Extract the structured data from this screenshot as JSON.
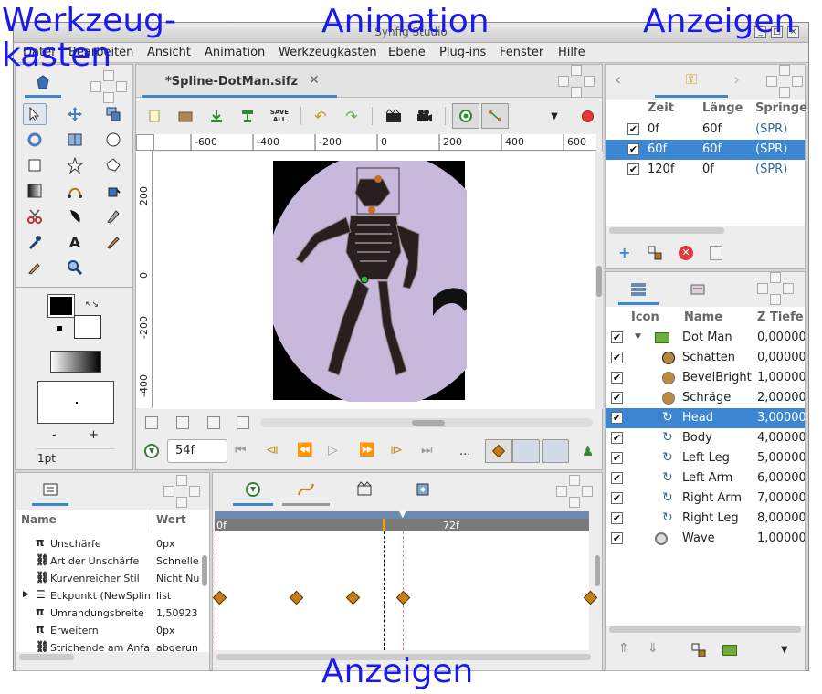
{
  "overlays": {
    "toolbox": "Werkzeug-\nkasten",
    "animation": "Animation",
    "display_top": "Anzeigen",
    "display_bottom": "Anzeigen"
  },
  "window": {
    "title": "Synfig Studio"
  },
  "menu": [
    "Datei",
    "Bearbeiten",
    "Ansicht",
    "Animation",
    "Werkzeugkasten",
    "Ebene",
    "Plug-ins",
    "Fenster",
    "Hilfe"
  ],
  "canvas": {
    "tab_title": "*Spline-DotMan.sifz",
    "toolbar_save_all": "SAVE ALL",
    "ruler_x": [
      "-600",
      "-400",
      "-200",
      "0",
      "200",
      "400",
      "600"
    ],
    "ruler_y": [
      "200",
      "0",
      "-200",
      "-400"
    ],
    "time_field": "54f",
    "ellipsis": "..."
  },
  "toolbox": {
    "width_label": "1pt",
    "minus": "-",
    "plus": "+"
  },
  "keyframes": {
    "headers": [
      "Zeit",
      "Länge",
      "Springe"
    ],
    "rows": [
      {
        "time": "0f",
        "length": "60f",
        "jump": "(SPR)",
        "selected": false
      },
      {
        "time": "60f",
        "length": "60f",
        "jump": "(SPR)",
        "selected": true
      },
      {
        "time": "120f",
        "length": "0f",
        "jump": "(SPR)",
        "selected": false
      }
    ]
  },
  "layers": {
    "headers": [
      "Icon",
      "Name",
      "Z Tiefe"
    ],
    "rows": [
      {
        "name": "Dot Man",
        "z": "0,000000",
        "icon": "folder-icon",
        "indent": 0,
        "selected": false
      },
      {
        "name": "Schatten",
        "z": "0,000000",
        "icon": "circle-layer-icon",
        "indent": 1,
        "selected": false
      },
      {
        "name": "BevelBright",
        "z": "1,000000",
        "icon": "circle-layer-icon",
        "indent": 1,
        "selected": false
      },
      {
        "name": "Schräge",
        "z": "2,000000",
        "icon": "circle-layer-icon",
        "indent": 1,
        "selected": false
      },
      {
        "name": "Head",
        "z": "3,000000",
        "icon": "spline-layer-icon",
        "indent": 1,
        "selected": true
      },
      {
        "name": "Body",
        "z": "4,000000",
        "icon": "spline-layer-icon",
        "indent": 1,
        "selected": false
      },
      {
        "name": "Left Leg",
        "z": "5,000000",
        "icon": "spline-layer-icon",
        "indent": 1,
        "selected": false
      },
      {
        "name": "Left Arm",
        "z": "6,000000",
        "icon": "spline-layer-icon",
        "indent": 1,
        "selected": false
      },
      {
        "name": "Right Arm",
        "z": "7,000000",
        "icon": "spline-layer-icon",
        "indent": 1,
        "selected": false
      },
      {
        "name": "Right Leg",
        "z": "8,000000",
        "icon": "spline-layer-icon",
        "indent": 1,
        "selected": false
      },
      {
        "name": "Wave",
        "z": "1,000000",
        "icon": "wave-layer-icon",
        "indent": 0,
        "selected": false
      }
    ]
  },
  "params": {
    "headers": [
      "Name",
      "Wert"
    ],
    "rows": [
      {
        "name": "Unschärfe",
        "value": "0px",
        "icon": "pi"
      },
      {
        "name": "Art der Unschärfe",
        "value": "Schnelle",
        "icon": "chain"
      },
      {
        "name": "Kurvenreicher Stil",
        "value": "Nicht Nu",
        "icon": "chain"
      },
      {
        "name": "Eckpunkt (NewSplin",
        "value": "list",
        "icon": "list"
      },
      {
        "name": "Umrandungsbreite",
        "value": "1,50923",
        "icon": "pi"
      },
      {
        "name": "Erweitern",
        "value": "0px",
        "icon": "pi"
      },
      {
        "name": "Strichende am Anfa",
        "value": "abgerun",
        "icon": "chain"
      }
    ]
  },
  "timetrack": {
    "label_start": "0f",
    "label_mid": "72f"
  },
  "colors": {
    "selection": "#3d86d4",
    "canvas_bg": "#c8b8dc",
    "keyframe": "#c47d17"
  }
}
